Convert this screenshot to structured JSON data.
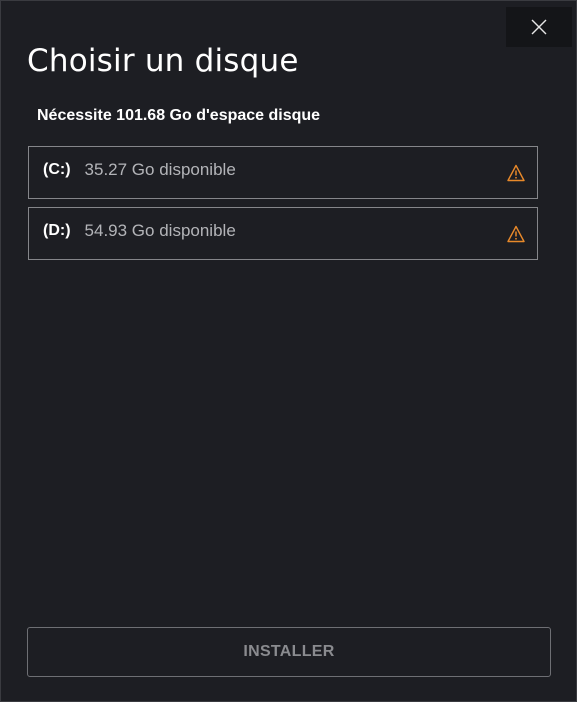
{
  "dialog": {
    "title": "Choisir un disque",
    "requirement": "Nécessite 101.68 Go d'espace disque",
    "close_icon": "close-icon"
  },
  "drives": [
    {
      "letter": "(C:)",
      "free": "35.27 Go disponible",
      "status_icon": "warning-icon"
    },
    {
      "letter": "(D:)",
      "free": "54.93 Go disponible",
      "status_icon": "warning-icon"
    }
  ],
  "footer": {
    "install_label": "INSTALLER"
  },
  "colors": {
    "background": "#1d1e23",
    "warning": "#e8892a",
    "text": "#ffffff",
    "muted_text": "#b3b4b8",
    "disabled_text": "#8a8b8f"
  }
}
